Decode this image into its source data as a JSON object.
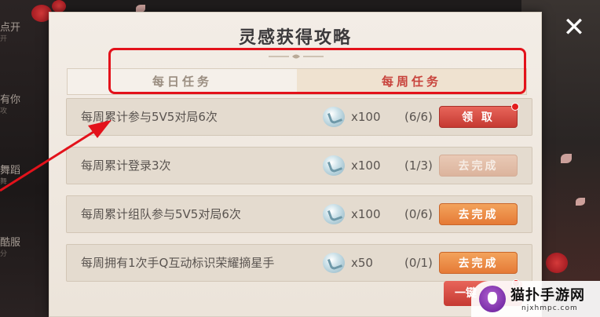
{
  "header": {
    "title": "灵感获得攻略",
    "close_glyph": "✕"
  },
  "tabs": [
    {
      "label": "每日任务",
      "active": false
    },
    {
      "label": "每周任务",
      "active": true
    }
  ],
  "tasks": [
    {
      "desc": "每周累计参与5V5对局6次",
      "reward_icon": "inspiration-gem-icon",
      "reward": "x100",
      "progress": "(6/6)",
      "action": "领 取",
      "state": "claim",
      "red_dot": true
    },
    {
      "desc": "每周累计登录3次",
      "reward_icon": "inspiration-gem-icon",
      "reward": "x100",
      "progress": "(1/3)",
      "action": "去完成",
      "state": "disabled",
      "red_dot": false
    },
    {
      "desc": "每周累计组队参与5V5对局6次",
      "reward_icon": "inspiration-gem-icon",
      "reward": "x100",
      "progress": "(0/6)",
      "action": "去完成",
      "state": "go",
      "red_dot": false
    },
    {
      "desc": "每周拥有1次手Q互动标识荣耀摘星手",
      "reward_icon": "inspiration-gem-icon",
      "reward": "x50",
      "progress": "(0/1)",
      "action": "去完成",
      "state": "go",
      "red_dot": false
    }
  ],
  "bottom_button": {
    "label": "一键",
    "red_dot": true
  },
  "watermark": {
    "title": "猫扑手游网",
    "subtitle": "njxhmpc.com"
  },
  "background": {
    "left_labels": [
      {
        "main": "点开",
        "sub": "开"
      },
      {
        "main": "有你",
        "sub": "攻"
      },
      {
        "main": "舞蹈",
        "sub": "舞"
      },
      {
        "main": "酷服",
        "sub": "分"
      }
    ]
  },
  "colors": {
    "highlight_border": "#e3121b",
    "active_tab_text": "#c8433c",
    "claim_button": "#c53a32",
    "go_button": "#e57a36",
    "disabled_button": "#dcb49d"
  }
}
